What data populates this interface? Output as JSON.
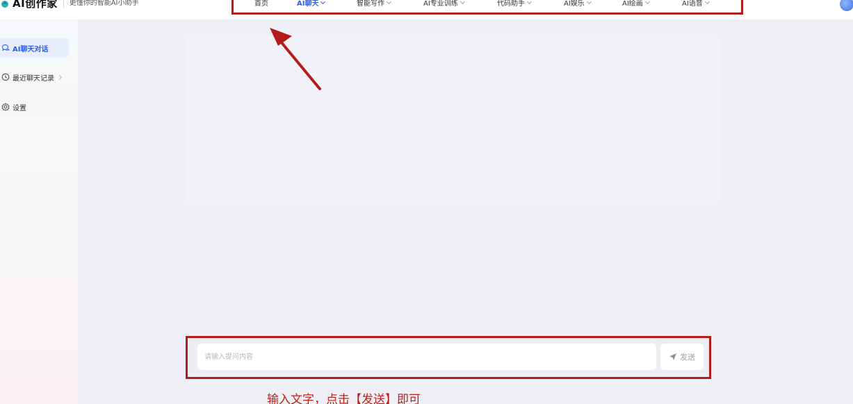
{
  "header": {
    "app_title": "AI创作家",
    "slogan": "更懂你的智能AI小助手",
    "nav": [
      {
        "label": "首页",
        "active": false,
        "has_dropdown": false
      },
      {
        "label": "AI聊天",
        "active": true,
        "has_dropdown": true
      },
      {
        "label": "智能写作",
        "active": false,
        "has_dropdown": true
      },
      {
        "label": "AI专业训练",
        "active": false,
        "has_dropdown": true
      },
      {
        "label": "代码助手",
        "active": false,
        "has_dropdown": true
      },
      {
        "label": "AI娱乐",
        "active": false,
        "has_dropdown": true
      },
      {
        "label": "AI绘画",
        "active": false,
        "has_dropdown": true
      },
      {
        "label": "AI语音",
        "active": false,
        "has_dropdown": true
      }
    ]
  },
  "sidebar": {
    "items": [
      {
        "label": "AI聊天对话",
        "icon": "chat-bubble-icon",
        "active": true
      },
      {
        "label": "最近聊天记录",
        "icon": "clock-icon",
        "active": false
      },
      {
        "label": "设置",
        "icon": "gear-icon",
        "active": false
      }
    ]
  },
  "composer": {
    "placeholder": "请输入提问内容",
    "send_label": "发送"
  },
  "annotation": {
    "caption": "输入文字，点击【发送】即可"
  },
  "colors": {
    "accent": "#2f5bea",
    "highlight_box": "#b21d1a",
    "caption": "#c0201c",
    "background": "#eef0f6"
  }
}
